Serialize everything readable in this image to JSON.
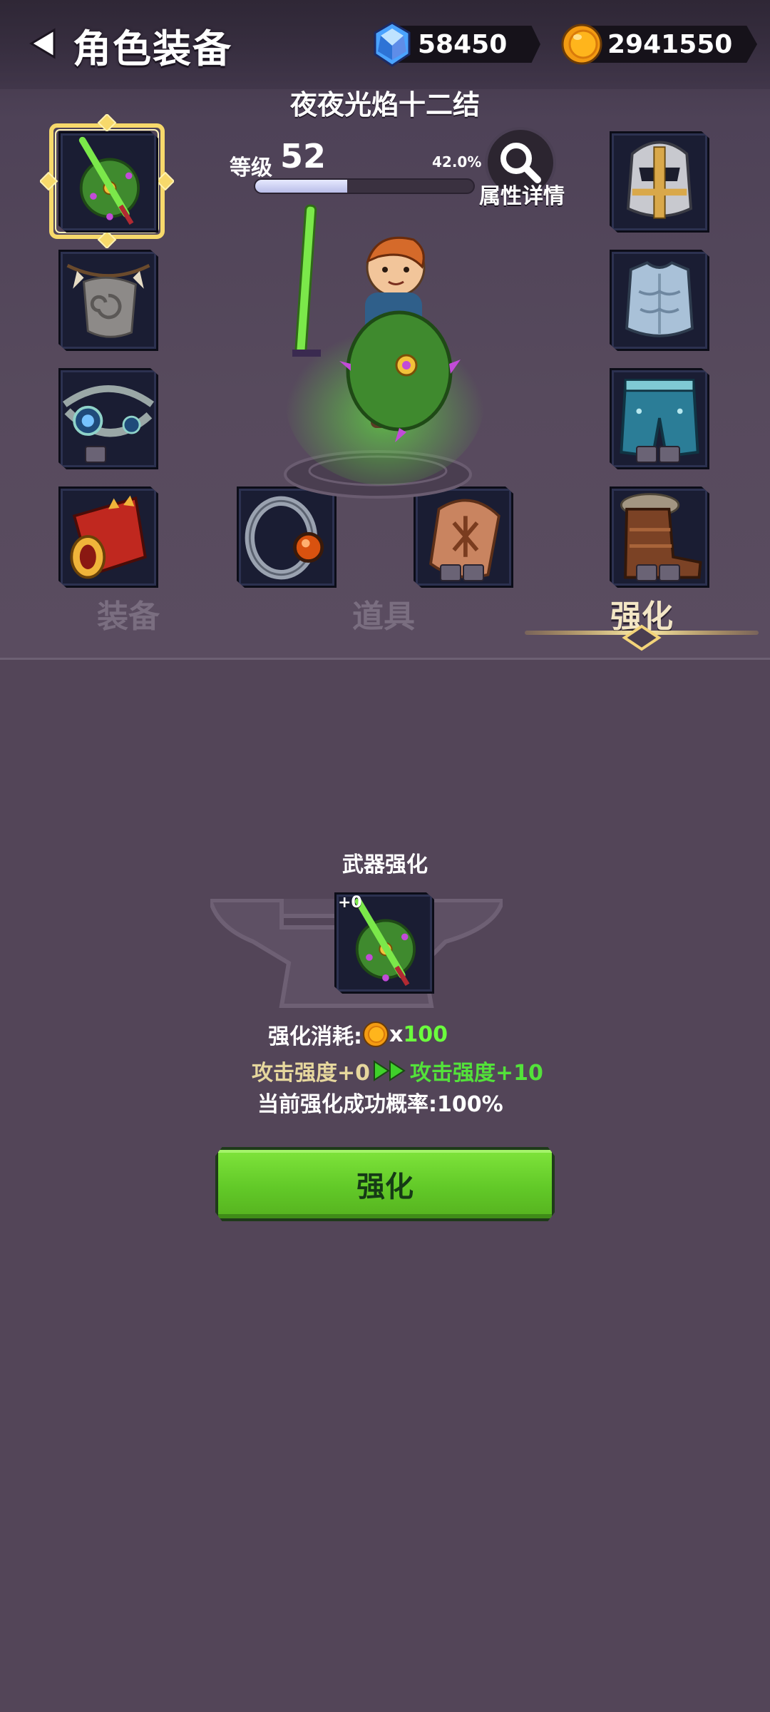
{
  "header": {
    "title": "角色装备",
    "gems": "58450",
    "coins": "2941550"
  },
  "character": {
    "equipment_name": "夜夜光焰十二结",
    "level_label": "等级",
    "level": "52",
    "exp_percent_text": "42.0%",
    "exp_fraction": 0.42,
    "detail_label": "属性详情"
  },
  "slots": {
    "left": [
      "weapon-shield-icon",
      "tooth-necklace-icon",
      "eye-amulet-icon"
    ],
    "right": [
      "knight-helmet-icon",
      "chest-armor-icon",
      "leg-armor-icon",
      "fur-boots-icon"
    ],
    "bottom": [
      "gauntlet-icon",
      "ring-icon",
      "rune-stone-icon"
    ]
  },
  "tabs": [
    {
      "label": "装备",
      "active": false
    },
    {
      "label": "道具",
      "active": false
    },
    {
      "label": "强化",
      "active": true
    }
  ],
  "upgrade": {
    "section_title": "武器强化",
    "item_level": "+0",
    "cost_label": "强化消耗:",
    "cost_x": "x",
    "cost_amount": "100",
    "attr_from": "攻击强度+0",
    "attr_to": "攻击强度+10",
    "success_rate": "当前强化成功概率:100%",
    "button_label": "强化"
  },
  "colors": {
    "background": "#534558",
    "accent_green": "#62c928",
    "gold": "#f3c24a"
  }
}
